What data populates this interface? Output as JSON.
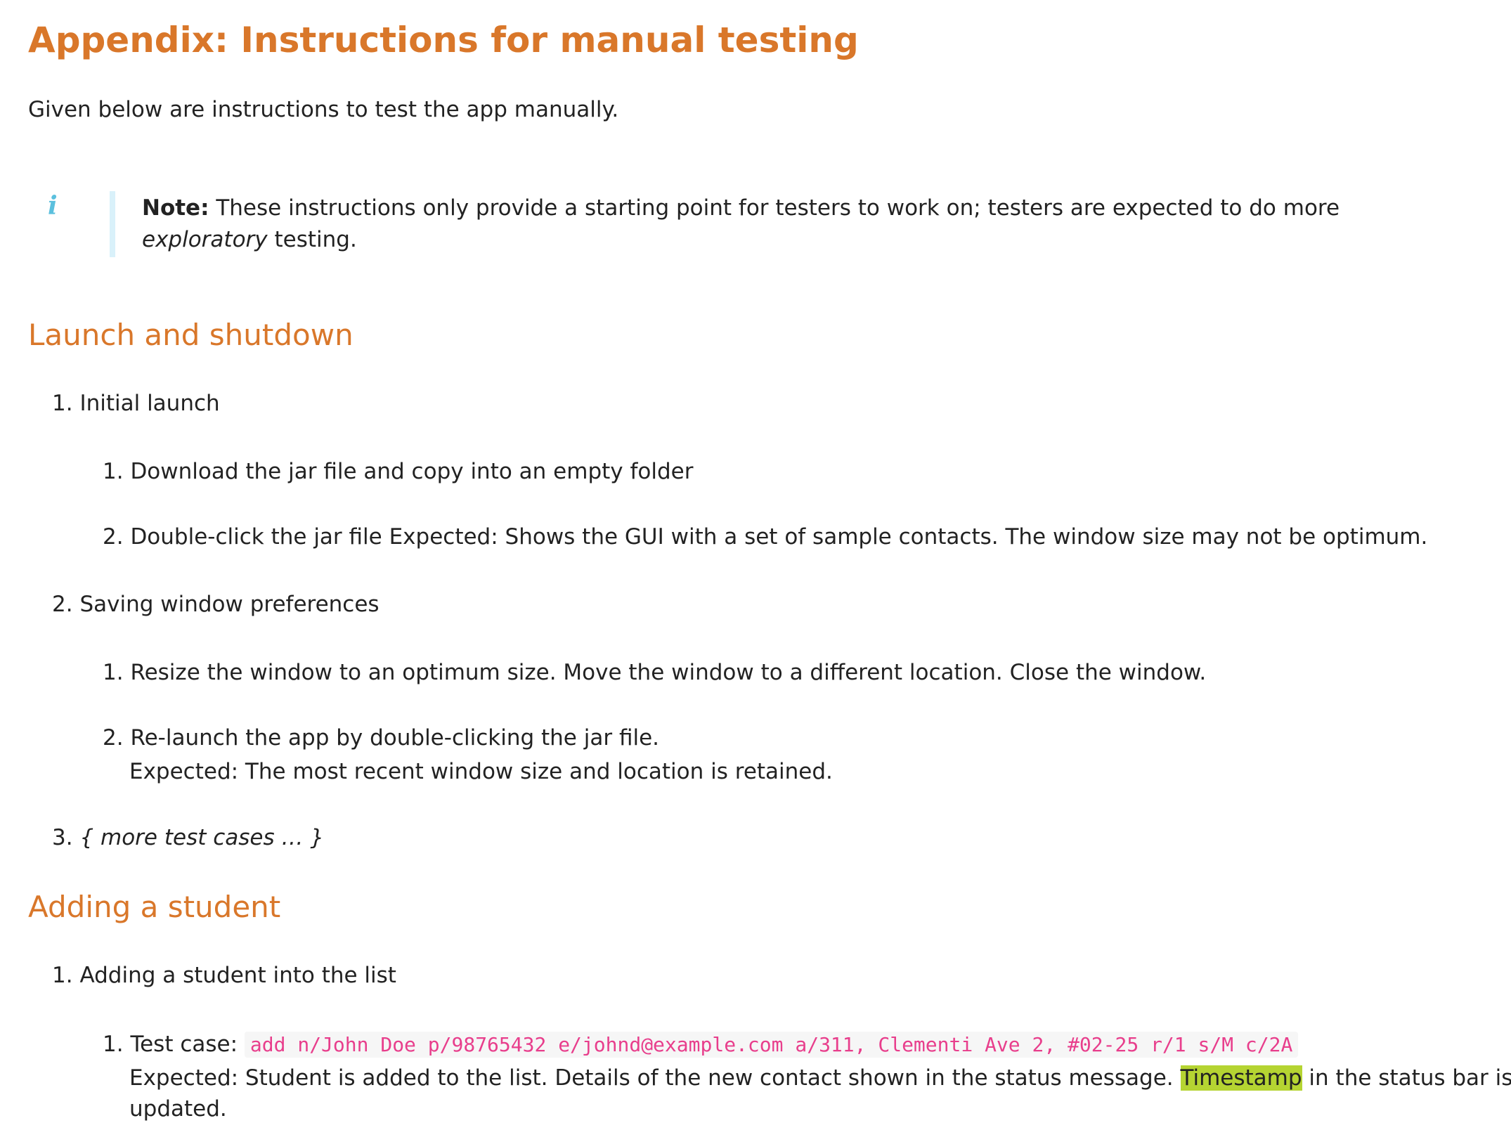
{
  "title": "Appendix: Instructions for manual testing",
  "intro": "Given below are instructions to test the app manually.",
  "note": {
    "icon": "info-icon",
    "label": "Note:",
    "text_before": "These instructions only provide a starting point for testers to work on; testers are expected to do more",
    "emphasis": "exploratory",
    "text_after": "testing."
  },
  "sections": {
    "launch": {
      "heading": "Launch and shutdown",
      "item1": {
        "num": "1.",
        "label": "Initial launch",
        "sub1_num": "1.",
        "sub1": "Download the jar file and copy into an empty folder",
        "sub2_num": "2.",
        "sub2": "Double-click the jar file Expected: Shows the GUI with a set of sample contacts. The window size may not be optimum."
      },
      "item2": {
        "num": "2.",
        "label": "Saving window preferences",
        "sub1_num": "1.",
        "sub1": "Resize the window to an optimum size. Move the window to a different location. Close the window.",
        "sub2_num": "2.",
        "sub2": "Re-launch the app by double-clicking the jar file.",
        "sub2_expected": "Expected: The most recent window size and location is retained."
      },
      "item3": {
        "num": "3.",
        "label": "{ more test cases … }"
      }
    },
    "adding": {
      "heading": "Adding a student",
      "item1": {
        "num": "1.",
        "label": "Adding a student into the list",
        "sub1_num": "1.",
        "sub1_prefix": "Test case:",
        "sub1_code": "add n/John Doe p/98765432 e/johnd@example.com a/311, Clementi Ave 2, #02-25 r/1 s/M c/2A",
        "expected_before": "Expected: Student is added to the list. Details of the new contact shown in the status message.",
        "expected_highlight": "Timestamp",
        "expected_after": "in the status bar is",
        "expected_wrap": "updated."
      }
    }
  },
  "colors": {
    "heading": "#d9772a",
    "info_icon": "#5bc0de",
    "note_bar": "#d9f1fa",
    "code_text": "#e83e8c",
    "highlight": "#b5d432"
  }
}
